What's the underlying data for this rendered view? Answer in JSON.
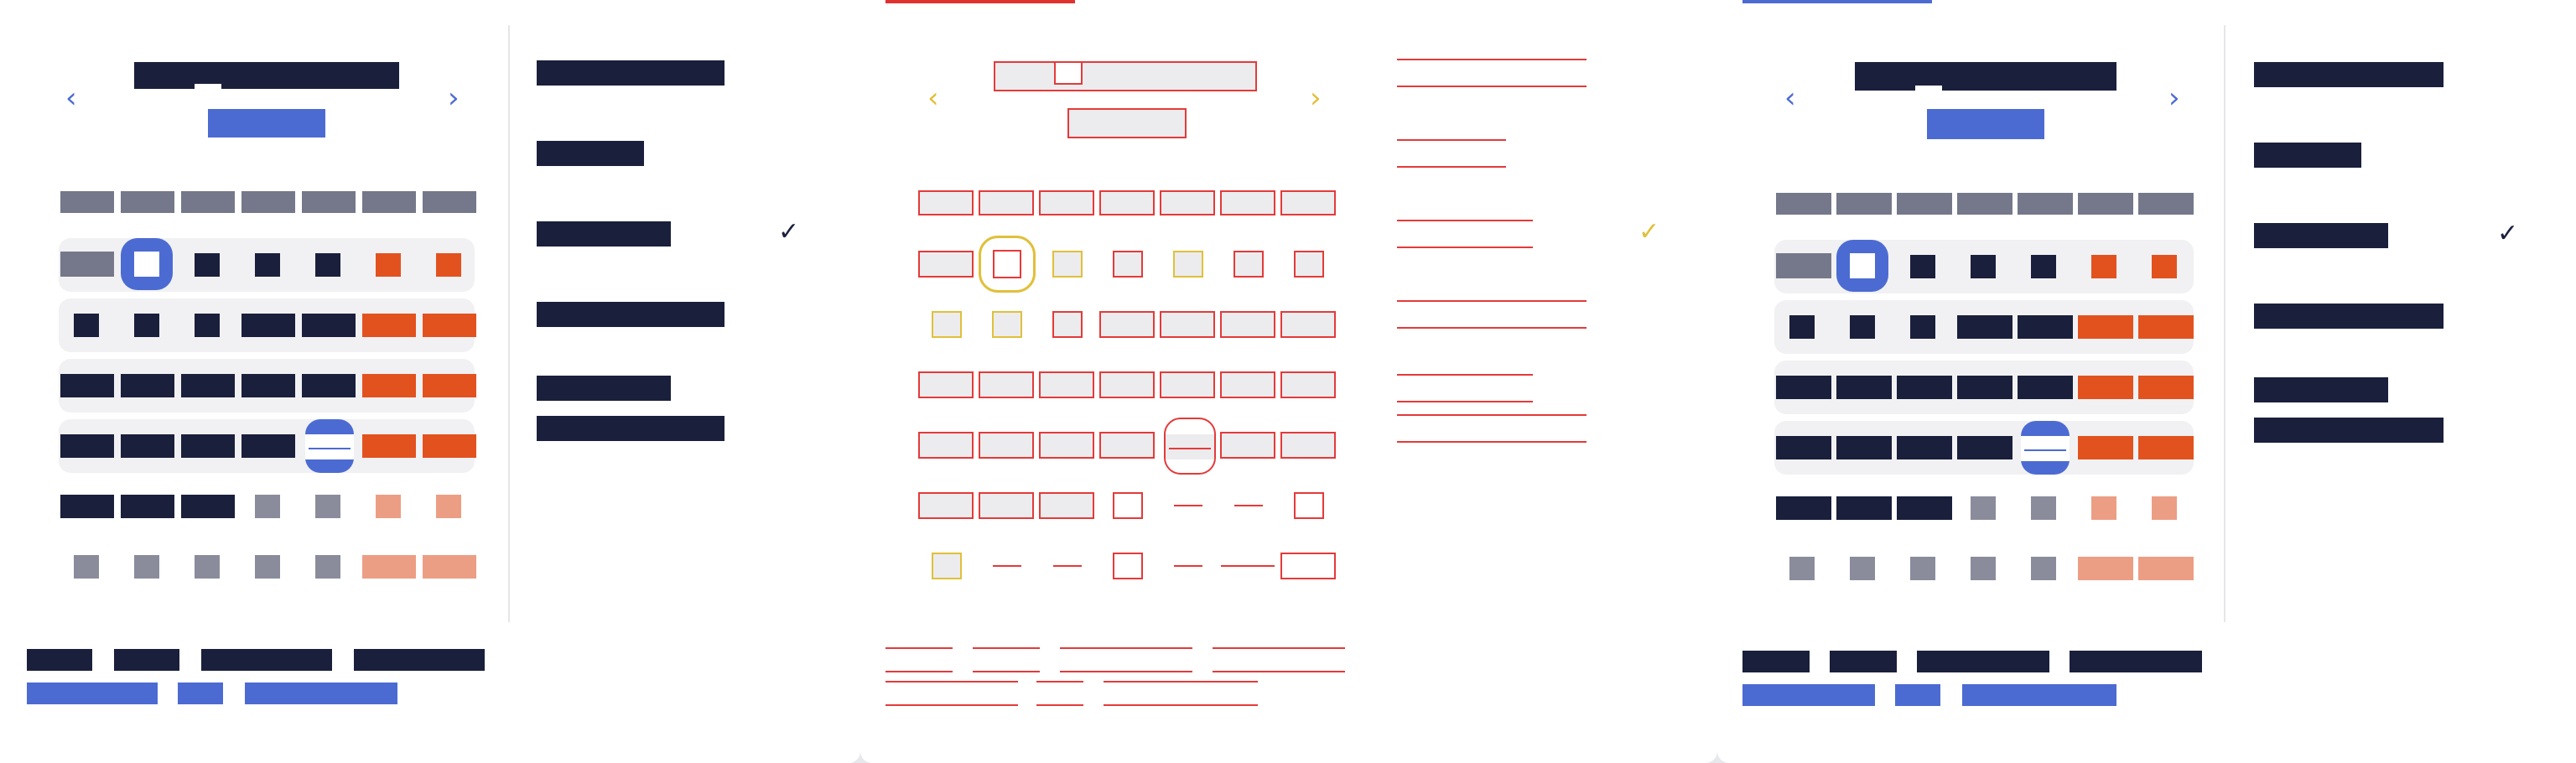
{
  "panels": [
    {
      "id": "calendar-redacted-solid",
      "variant": "solid"
    },
    {
      "id": "calendar-redacted-outline",
      "variant": "outline"
    },
    {
      "id": "calendar-redacted-solid-copy",
      "variant": "solid"
    }
  ],
  "icons": {
    "prev_month": "‹",
    "next_month": "›",
    "selected_check": "✓"
  },
  "colors": {
    "accent_blue": "#4c6bd2",
    "redaction_dark": "#1a1f3c",
    "weekend_orange": "#e2521f",
    "weekend_faded": "#ec9e84",
    "outline_red": "#e43a3a",
    "outline_yellow": "#e0c03a"
  },
  "note_visible_text": ""
}
